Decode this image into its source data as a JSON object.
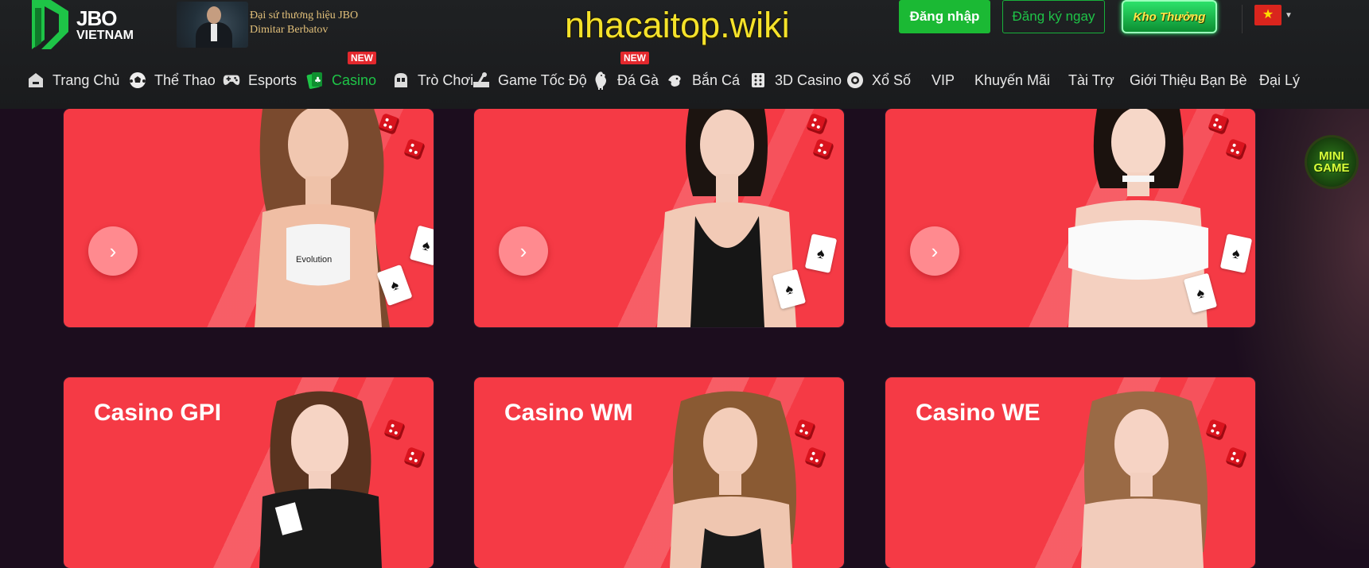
{
  "brand": {
    "logo_line1": "JBO",
    "logo_line2": "VIETNAM",
    "ambassador_line1": "Đại sứ thương hiệu JBO",
    "ambassador_line2": "Dimitar Berbatov",
    "watermark": "nhacaitop.wiki"
  },
  "header_actions": {
    "login_label": "Đăng nhập",
    "register_label": "Đăng ký ngay",
    "reward_label": "Kho Thưởng",
    "language_icon": "vietnam-flag-icon"
  },
  "nav": {
    "items": [
      {
        "label": "Trang Chủ",
        "icon": "home-icon"
      },
      {
        "label": "Thể Thao",
        "icon": "soccer-ball-icon"
      },
      {
        "label": "Esports",
        "icon": "gamepad-icon"
      },
      {
        "label": "Casino",
        "icon": "casino-chip-icon",
        "active": true,
        "badge": "NEW"
      },
      {
        "label": "Trò Chơi",
        "icon": "slot-machine-icon"
      },
      {
        "label": "Game Tốc Độ",
        "icon": "speed-game-icon"
      },
      {
        "label": "Đá Gà",
        "icon": "rooster-icon",
        "badge": "NEW"
      },
      {
        "label": "Bắn Cá",
        "icon": "fish-icon"
      },
      {
        "label": "3D Casino",
        "icon": "dice-icon"
      },
      {
        "label": "Xổ Số",
        "icon": "lottery-ball-icon"
      },
      {
        "label": "VIP"
      },
      {
        "label": "Khuyến Mãi"
      },
      {
        "label": "Tài Trợ"
      },
      {
        "label": "Giới Thiệu Bạn Bè"
      },
      {
        "label": "Đại Lý"
      }
    ]
  },
  "cards": {
    "row2": [
      {
        "title": "Casino GPI"
      },
      {
        "title": "Casino WM"
      },
      {
        "title": "Casino WE"
      }
    ],
    "arrow_glyph": "›",
    "shirt_text": "Evolution"
  },
  "floating": {
    "mini_game_line1": "MINI",
    "mini_game_line2": "GAME"
  },
  "colors": {
    "accent_green": "#1bb934",
    "card_red": "#f53a45",
    "background": "#1c0d1e",
    "badge_red": "#e3282d"
  }
}
